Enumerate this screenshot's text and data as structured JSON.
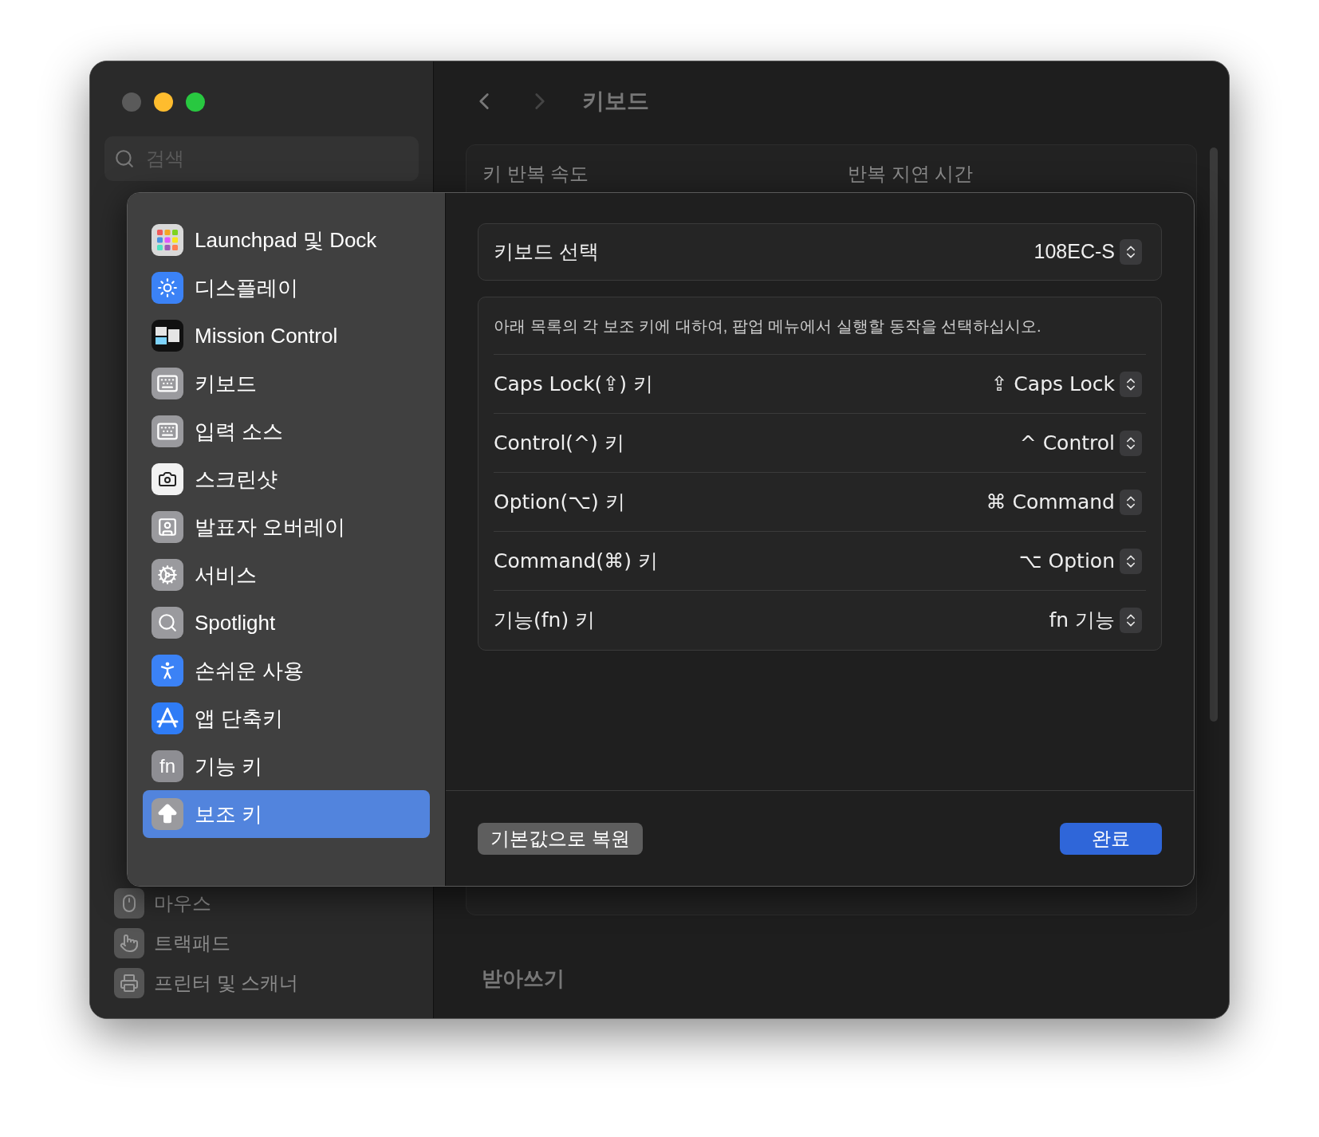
{
  "sidebar": {
    "search": {
      "placeholder": "검색"
    },
    "items": [
      {
        "label": "마우스"
      },
      {
        "label": "트랙패드"
      },
      {
        "label": "프린터 및 스캐너"
      }
    ]
  },
  "toolbar": {
    "title": "키보드"
  },
  "content": {
    "key_repeat_label": "키 반복 속도",
    "delay_label": "반복 지연 시간",
    "section_title": "받아쓰기"
  },
  "sheet": {
    "categories": [
      {
        "label": "Launchpad 및 Dock",
        "selected": false
      },
      {
        "label": "디스플레이",
        "selected": false
      },
      {
        "label": "Mission Control",
        "selected": false
      },
      {
        "label": "키보드",
        "selected": false
      },
      {
        "label": "입력 소스",
        "selected": false
      },
      {
        "label": "스크린샷",
        "selected": false
      },
      {
        "label": "발표자 오버레이",
        "selected": false
      },
      {
        "label": "서비스",
        "selected": false
      },
      {
        "label": "Spotlight",
        "selected": false
      },
      {
        "label": "손쉬운 사용",
        "selected": false
      },
      {
        "label": "앱 단축키",
        "selected": false
      },
      {
        "label": "기능 키",
        "selected": false,
        "icon_text": "fn"
      },
      {
        "label": "보조 키",
        "selected": true
      }
    ],
    "keyboard_select": {
      "label": "키보드 선택",
      "value": "108EC-S"
    },
    "description": "아래 목록의 각 보조 키에 대하여, 팝업 메뉴에서 실행할 동작을 선택하십시오.",
    "modifiers": [
      {
        "label": "Caps Lock(⇪) 키",
        "value": "⇪ Caps Lock"
      },
      {
        "label": "Control(^) 키",
        "value": "^ Control"
      },
      {
        "label": "Option(⌥) 키",
        "value": "⌘ Command"
      },
      {
        "label": "Command(⌘) 키",
        "value": "⌥ Option"
      },
      {
        "label": "기능(fn) 키",
        "value": "fn 기능"
      }
    ],
    "buttons": {
      "restore": "기본값으로 복원",
      "done": "완료"
    }
  }
}
